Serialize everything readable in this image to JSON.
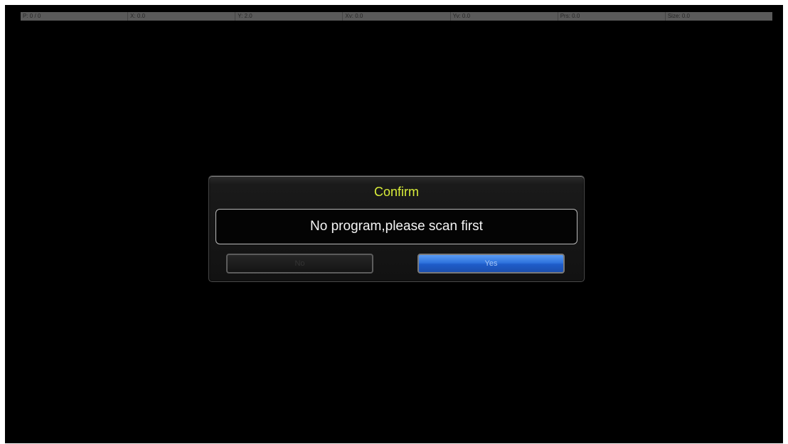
{
  "status_bar": {
    "fields": [
      "P: 0 / 0",
      "X: 0.0",
      "Y: 2.0",
      "Xv: 0.0",
      "Yv: 0.0",
      "Prs: 0.0",
      "Size: 0.0"
    ]
  },
  "dialog": {
    "title": "Confirm",
    "message": "No program,please scan first",
    "no_label": "No",
    "yes_label": "Yes"
  },
  "colors": {
    "title": "#d8ec3a",
    "yes_button": "#2f73dd",
    "background": "#000000"
  }
}
